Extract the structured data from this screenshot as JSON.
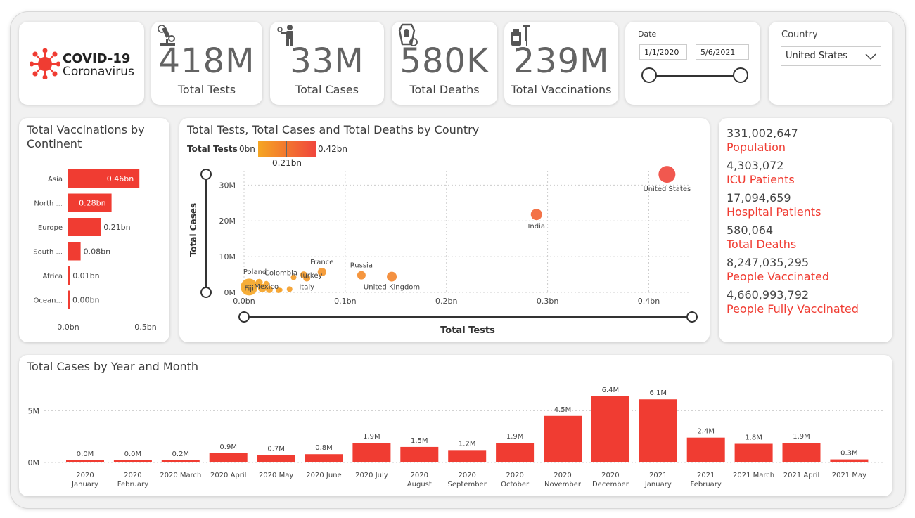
{
  "logo": {
    "title": "COVID-19",
    "subtitle": "Coronavirus"
  },
  "kpis": [
    {
      "value": "418M",
      "label": "Total Tests",
      "icon": "microscope-icon"
    },
    {
      "value": "33M",
      "label": "Total Cases",
      "icon": "person-virus-icon"
    },
    {
      "value": "580K",
      "label": "Total Deaths",
      "icon": "coffin-icon"
    },
    {
      "value": "239M",
      "label": "Total Vaccinations",
      "icon": "vaccine-icon"
    }
  ],
  "date_filter": {
    "label": "Date",
    "start": "1/1/2020",
    "end": "5/6/2021"
  },
  "country_filter": {
    "label": "Country",
    "value": "United States"
  },
  "vacc_by_continent": {
    "title": "Total Vaccinations by Continent",
    "axis_labels": [
      "0.0bn",
      "0.5bn"
    ]
  },
  "scatter": {
    "title": "Total Tests, Total Cases and Total Deaths by Country",
    "legend_label": "Total Tests",
    "legend_min": "0bn",
    "legend_max": "0.42bn",
    "legend_mid": "0.21bn",
    "xlabel": "Total Tests",
    "ylabel": "Total Cases",
    "x_ticks": [
      "0.0bn",
      "0.1bn",
      "0.2bn",
      "0.3bn",
      "0.4bn"
    ],
    "y_ticks": [
      "0M",
      "10M",
      "20M",
      "30M"
    ]
  },
  "stats": [
    {
      "value": "331,002,647",
      "label": "Population"
    },
    {
      "value": "4,303,072",
      "label": "ICU Patients"
    },
    {
      "value": "17,094,659",
      "label": "Hospital Patients"
    },
    {
      "value": "580,064",
      "label": "Total Deaths"
    },
    {
      "value": "8,247,035,295",
      "label": "People Vaccinated"
    },
    {
      "value": "4,660,993,792",
      "label": "People Fully Vaccinated"
    }
  ],
  "monthly": {
    "title": "Total Cases by Year and Month",
    "y_ticks": [
      "0M",
      "5M"
    ]
  },
  "colors": {
    "accent": "#f03c32",
    "bubble_low": "#f5a623",
    "bubble_high": "#f0463c"
  },
  "chart_data": [
    {
      "type": "bar",
      "title": "Total Vaccinations by Continent",
      "orientation": "horizontal",
      "categories": [
        "Asia",
        "North ...",
        "Europe",
        "South ...",
        "Africa",
        "Ocean..."
      ],
      "values": [
        0.46,
        0.28,
        0.21,
        0.08,
        0.01,
        0.004
      ],
      "labels": [
        "0.46bn",
        "0.28bn",
        "0.21bn",
        "0.08bn",
        "0.01bn",
        "0.00bn"
      ],
      "xlim": [
        0,
        0.5
      ]
    },
    {
      "type": "scatter",
      "title": "Total Tests, Total Cases and Total Deaths by Country",
      "xlabel": "Total Tests",
      "ylabel": "Total Cases",
      "xlim": [
        0,
        0.44
      ],
      "ylim": [
        0,
        34
      ],
      "points": [
        {
          "label": "United States",
          "x": 0.418,
          "y": 33,
          "r": 12
        },
        {
          "label": "India",
          "x": 0.289,
          "y": 21.8,
          "r": 8
        },
        {
          "label": "Russia",
          "x": 0.116,
          "y": 4.8,
          "r": 6
        },
        {
          "label": "United Kingdom",
          "x": 0.146,
          "y": 4.4,
          "r": 7
        },
        {
          "label": "France",
          "x": 0.077,
          "y": 5.7,
          "r": 6
        },
        {
          "label": "Turkey",
          "x": 0.059,
          "y": 4.9,
          "r": 5
        },
        {
          "label": "Colombia",
          "x": 0.049,
          "y": 4.2,
          "r": 4
        },
        {
          "label": "Italy",
          "x": 0.062,
          "y": 4.0,
          "r": 5
        },
        {
          "label": "Mexico",
          "x": 0.022,
          "y": 2.4,
          "r": 4
        },
        {
          "label": "Poland",
          "x": 0.015,
          "y": 2.8,
          "r": 5
        },
        {
          "label": "Fiji",
          "x": 0.005,
          "y": 1.5,
          "r": 12
        },
        {
          "label": "",
          "x": 0.018,
          "y": 1.2,
          "r": 6
        },
        {
          "label": "",
          "x": 0.025,
          "y": 0.8,
          "r": 5
        },
        {
          "label": "",
          "x": 0.034,
          "y": 0.6,
          "r": 4
        },
        {
          "label": "",
          "x": 0.045,
          "y": 0.9,
          "r": 4
        },
        {
          "label": "",
          "x": 0.036,
          "y": 0.7,
          "r": 3
        }
      ]
    },
    {
      "type": "bar",
      "title": "Total Cases by Year and Month",
      "categories": [
        "2020 January",
        "2020 February",
        "2020 March",
        "2020 April",
        "2020 May",
        "2020 June",
        "2020 July",
        "2020 August",
        "2020 September",
        "2020 October",
        "2020 November",
        "2020 December",
        "2021 January",
        "2021 February",
        "2021 March",
        "2021 April",
        "2021 May"
      ],
      "values": [
        0.0,
        0.0,
        0.2,
        0.9,
        0.7,
        0.8,
        1.9,
        1.5,
        1.2,
        1.9,
        4.5,
        6.4,
        6.1,
        2.4,
        1.8,
        1.9,
        0.3
      ],
      "labels": [
        "0.0M",
        "0.0M",
        "0.2M",
        "0.9M",
        "0.7M",
        "0.8M",
        "1.9M",
        "1.5M",
        "1.2M",
        "1.9M",
        "4.5M",
        "6.4M",
        "6.1M",
        "2.4M",
        "1.8M",
        "1.9M",
        "0.3M"
      ],
      "ylim": [
        0,
        7
      ],
      "yunit": "M"
    }
  ]
}
